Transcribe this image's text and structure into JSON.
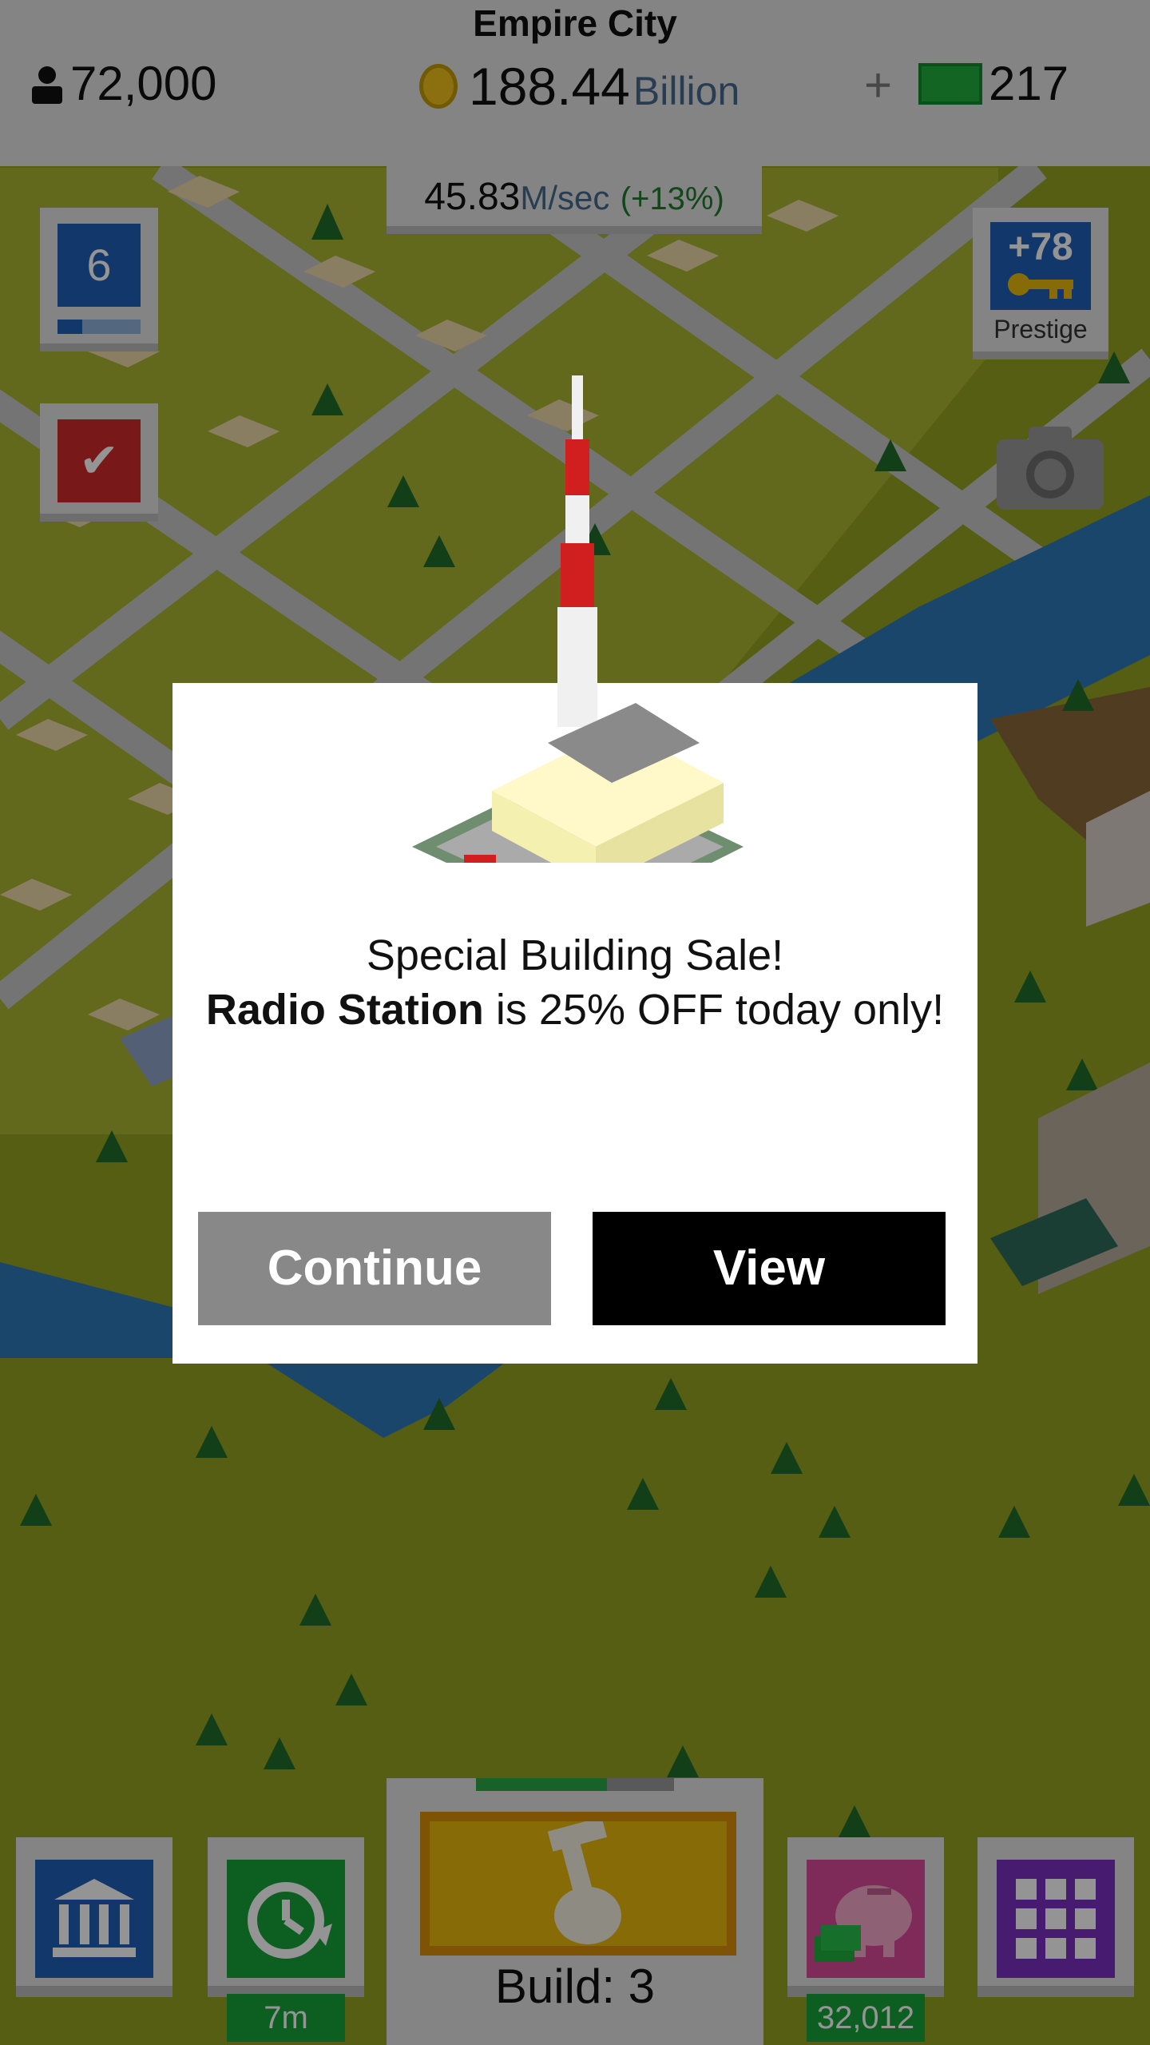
{
  "header": {
    "city_name": "Empire City",
    "population": "72,000",
    "money_value": "188.44",
    "money_unit": "Billion",
    "plus": "+",
    "bucks": "217",
    "rate_value": "45.83",
    "rate_unit": "M/sec",
    "rate_bonus": "(+13%)"
  },
  "left_panel": {
    "level": "6",
    "level_progress": 0.3,
    "tasks_icon": "checkmark-icon"
  },
  "right_panel": {
    "prestige_value": "+78",
    "prestige_label": "Prestige",
    "camera_icon": "camera-icon"
  },
  "dialog": {
    "line1": "Special Building Sale!",
    "building_name": "Radio Station",
    "line2_suffix": " is 25% OFF today only!",
    "continue_label": "Continue",
    "view_label": "View",
    "image": "radio-station-building"
  },
  "bottom_bar": {
    "bank_icon": "bank-icon",
    "timer_icon": "clock-refresh-icon",
    "timer_label": "7m",
    "build_label": "Build: 3",
    "build_progress": 0.66,
    "build_icon": "hammer-hand-icon",
    "piggy_icon": "piggy-bank-icon",
    "piggy_value": "32,012",
    "menu_icon": "grid-icon"
  },
  "colors": {
    "coin": "#f2c21b",
    "bucks": "#1fae3d",
    "blue_tile": "#1f5fb8",
    "red_tile": "#d12a2a",
    "green_tile": "#17a33a",
    "build_yellow": "#e9b90c",
    "piggy_pink": "#d94b9a",
    "menu_purple": "#7b2fc1"
  }
}
